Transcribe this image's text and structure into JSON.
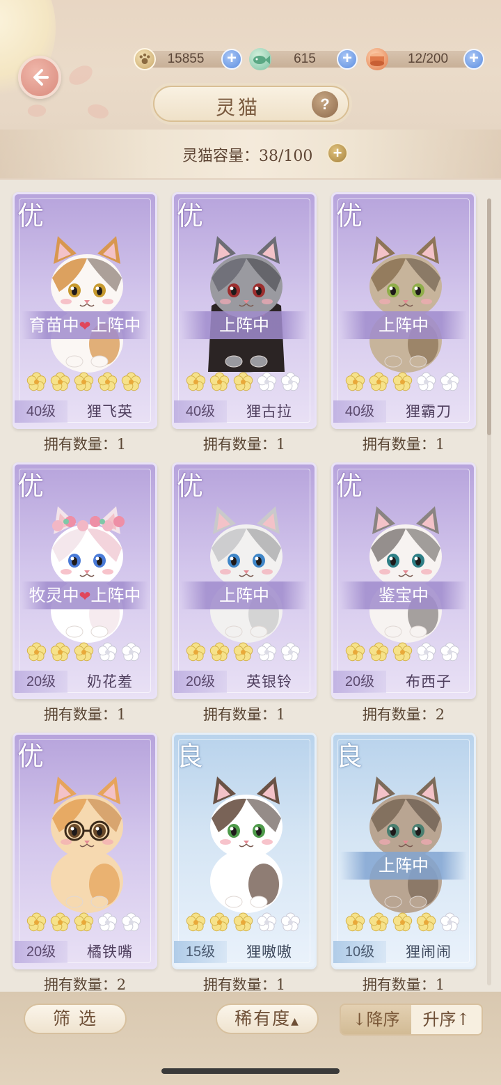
{
  "resources": [
    {
      "icon": "paw-coin-icon",
      "value": "15855"
    },
    {
      "icon": "fish-leaf-icon",
      "value": "615"
    },
    {
      "icon": "can-food-icon",
      "value": "12/200"
    }
  ],
  "header": {
    "title": "灵猫",
    "help": "?"
  },
  "capacity": {
    "label": "灵猫容量：38/100"
  },
  "cats": [
    {
      "grade": "优",
      "status": "育苗中",
      "status2": "上阵中",
      "stars": 5,
      "level": "40级",
      "name": "狸飞英",
      "owned": "拥有数量：1",
      "theme": "purple"
    },
    {
      "grade": "优",
      "status": "上阵中",
      "status2": "",
      "stars": 3,
      "level": "40级",
      "name": "狸古拉",
      "owned": "拥有数量：1",
      "theme": "purple"
    },
    {
      "grade": "优",
      "status": "上阵中",
      "status2": "",
      "stars": 3,
      "level": "40级",
      "name": "狸霸刀",
      "owned": "拥有数量：1",
      "theme": "purple"
    },
    {
      "grade": "优",
      "status": "牧灵中",
      "status2": "上阵中",
      "stars": 3,
      "level": "20级",
      "name": "奶花羞",
      "owned": "拥有数量：1",
      "theme": "purple"
    },
    {
      "grade": "优",
      "status": "上阵中",
      "status2": "",
      "stars": 3,
      "level": "20级",
      "name": "英银铃",
      "owned": "拥有数量：1",
      "theme": "purple"
    },
    {
      "grade": "优",
      "status": "鉴宝中",
      "status2": "",
      "stars": 3,
      "level": "20级",
      "name": "布西子",
      "owned": "拥有数量：2",
      "theme": "purple"
    },
    {
      "grade": "优",
      "status": "",
      "status2": "",
      "stars": 3,
      "level": "20级",
      "name": "橘铁嘴",
      "owned": "拥有数量：2",
      "theme": "purple"
    },
    {
      "grade": "良",
      "status": "",
      "status2": "",
      "stars": 3,
      "level": "15级",
      "name": "狸嗷嗷",
      "owned": "拥有数量：1",
      "theme": "blue"
    },
    {
      "grade": "良",
      "status": "上阵中",
      "status2": "",
      "stars": 4,
      "level": "10级",
      "name": "狸闹闹",
      "owned": "拥有数量：1",
      "theme": "blue"
    }
  ],
  "bottom": {
    "filter": "筛 选",
    "rarity": "稀有度",
    "desc": "↓降序",
    "asc": "升序↑"
  },
  "colors": {
    "accent_plus": "#5d8ee0",
    "purple_card": "#b7a4dc",
    "blue_card": "#b9d3ec",
    "star_yellow": "#f6e28a",
    "star_white": "#ffffff"
  }
}
